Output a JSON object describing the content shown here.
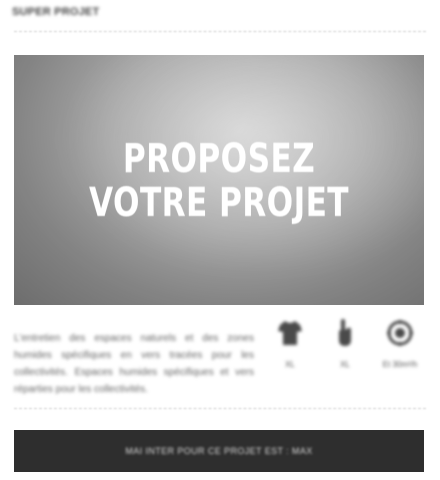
{
  "section": {
    "title": "SUPER PROJET"
  },
  "hero": {
    "line1": "PROPOSEZ",
    "line2": "VOTRE PROJET"
  },
  "description": {
    "text": "L'entretien des espaces naturels et des zones humides spécifiques en vers tracées pour les collectivités. Espaces humides spécifiques et vers réparties pour les collectivités."
  },
  "specs": [
    {
      "icon": "tshirt-icon",
      "label": "XL"
    },
    {
      "icon": "hand-icon",
      "label": "XL"
    },
    {
      "icon": "cog-icon",
      "label": "Et 30m²/h"
    }
  ],
  "cta": {
    "label": "MAI INTER POUR CE PROJET EST : MAX"
  },
  "colors": {
    "button_bg": "#2e2e2e",
    "hero_text": "#ffffff"
  }
}
